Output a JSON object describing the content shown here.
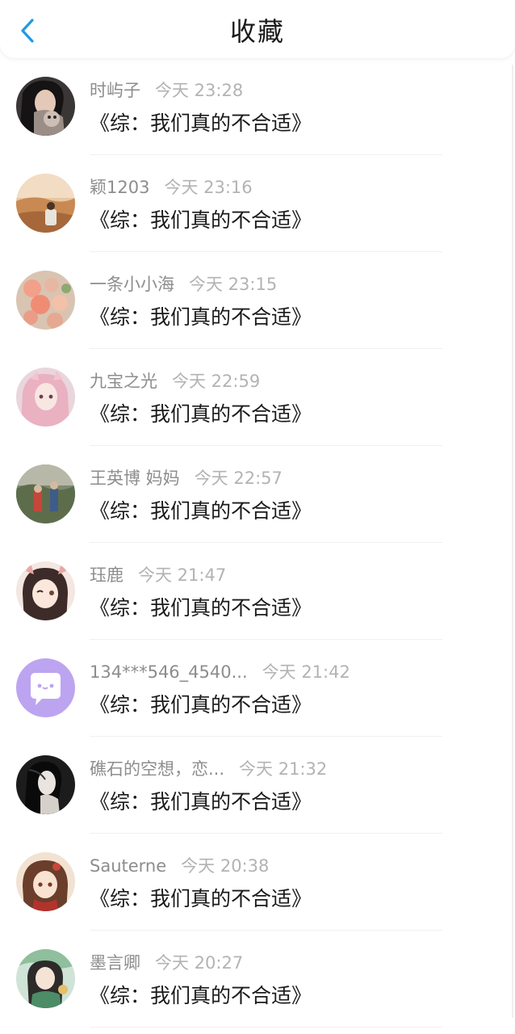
{
  "header": {
    "title": "收藏",
    "back_icon": "chevron-left-icon",
    "accent": "#1e9be6"
  },
  "items": [
    {
      "name": "时屿子",
      "time": "今天 23:28",
      "title": "《综：我们真的不合适》",
      "avatar": "photo-cat"
    },
    {
      "name": "颖1203",
      "time": "今天 23:16",
      "title": "《综：我们真的不合适》",
      "avatar": "photo-desert"
    },
    {
      "name": "一条小小海",
      "time": "今天 23:15",
      "title": "《综：我们真的不合适》",
      "avatar": "photo-flowers"
    },
    {
      "name": "九宝之光",
      "time": "今天 22:59",
      "title": "《综：我们真的不合适》",
      "avatar": "anime-pink"
    },
    {
      "name": "王英博 妈妈",
      "time": "今天 22:57",
      "title": "《综：我们真的不合适》",
      "avatar": "photo-outdoor"
    },
    {
      "name": "珏鹿",
      "time": "今天 21:47",
      "title": "《综：我们真的不合适》",
      "avatar": "anime-wink"
    },
    {
      "name": "134***546_4540...",
      "time": "今天 21:42",
      "title": "《综：我们真的不合适》",
      "avatar": "default-chat"
    },
    {
      "name": "礁石的空想，恋...",
      "time": "今天 21:32",
      "title": "《综：我们真的不合适》",
      "avatar": "sketch-girl"
    },
    {
      "name": "Sauterne",
      "time": "今天 20:38",
      "title": "《综：我们真的不合适》",
      "avatar": "anime-warm"
    },
    {
      "name": "墨言卿",
      "time": "今天 20:27",
      "title": "《综：我们真的不合适》",
      "avatar": "anime-green"
    }
  ]
}
